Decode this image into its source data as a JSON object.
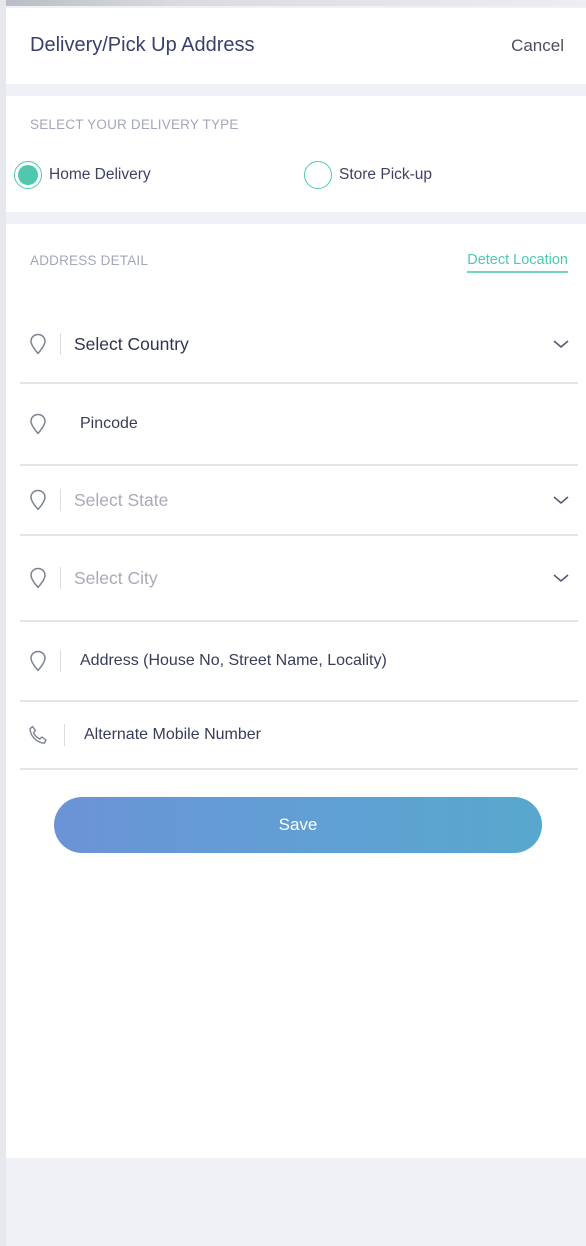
{
  "header": {
    "title": "Delivery/Pick Up Address",
    "cancel_label": "Cancel"
  },
  "delivery_type": {
    "section_label": "SELECT YOUR DELIVERY TYPE",
    "options": [
      {
        "label": "Home Delivery",
        "selected": true
      },
      {
        "label": "Store Pick-up",
        "selected": false
      }
    ]
  },
  "address": {
    "section_label": "ADDRESS DETAIL",
    "detect_label": "Detect Location",
    "fields": [
      {
        "text": "Select Country",
        "icon": "location-pin-icon",
        "dropdown": true,
        "state": "value"
      },
      {
        "text": "Pincode",
        "icon": "location-pin-icon",
        "dropdown": false,
        "state": "placeholder"
      },
      {
        "text": "Select State",
        "icon": "location-pin-icon",
        "dropdown": true,
        "state": "placeholder"
      },
      {
        "text": "Select City",
        "icon": "location-pin-icon",
        "dropdown": true,
        "state": "placeholder"
      },
      {
        "text": "Address (House No, Street Name, Locality)",
        "icon": "location-pin-icon",
        "dropdown": false,
        "state": "placeholder"
      },
      {
        "text": "Alternate Mobile Number",
        "icon": "phone-icon",
        "dropdown": false,
        "state": "placeholder"
      }
    ],
    "save_label": "Save"
  },
  "colors": {
    "accent": "#4fc9ae",
    "button_start": "#6b93d6",
    "button_end": "#58a7ce",
    "title": "#3a3f6b"
  }
}
